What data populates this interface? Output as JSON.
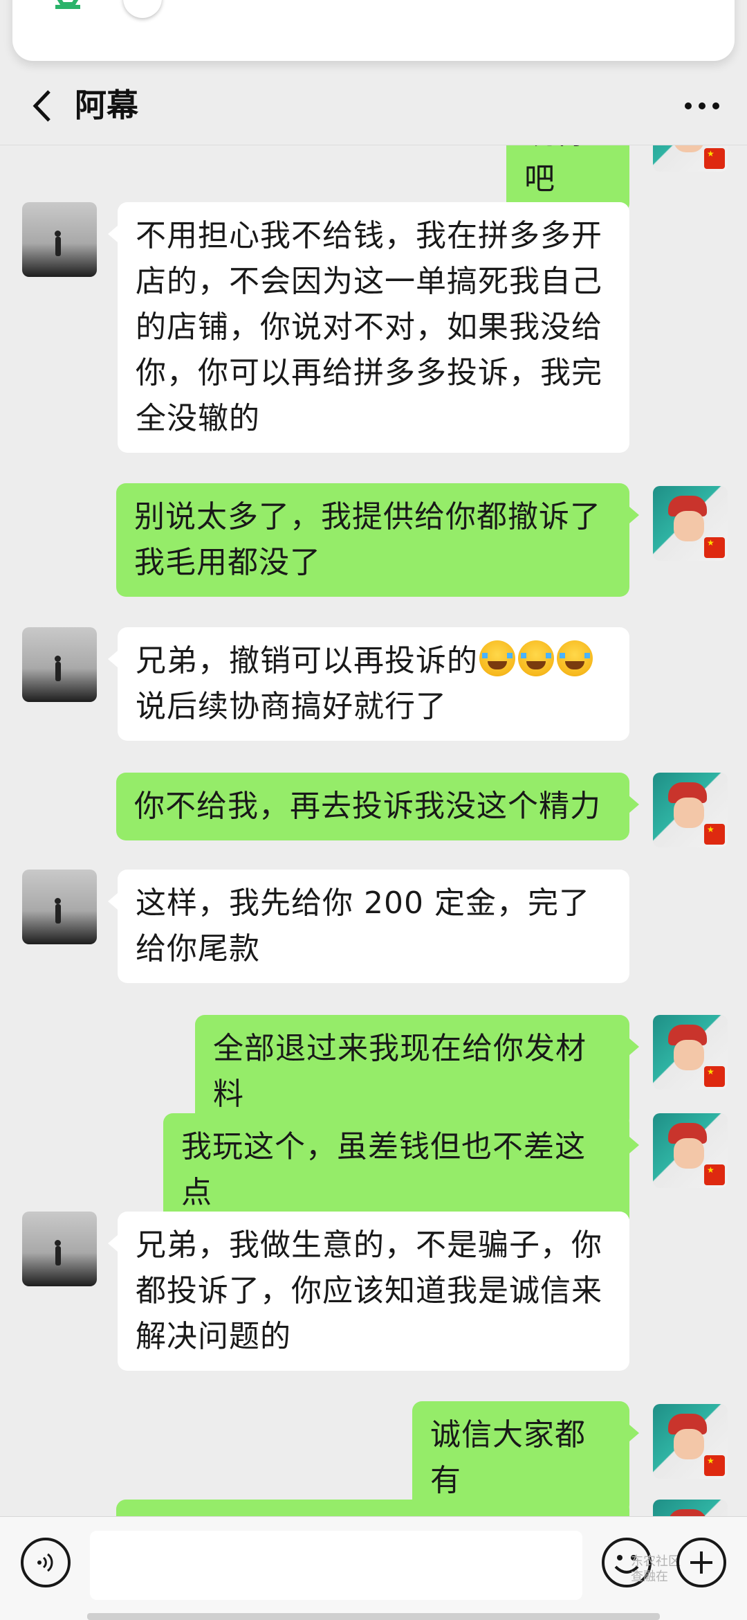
{
  "header": {
    "title": "阿幕"
  },
  "messages": [
    {
      "side": "right",
      "text": "晓得吧"
    },
    {
      "side": "left",
      "text": "不用担心我不给钱，我在拼多多开店的，不会因为这一单搞死我自己的店铺，你说对不对，如果我没给你，你可以再给拼多多投诉，我完全没辙的"
    },
    {
      "side": "right",
      "text": "别说太多了，我提供给你都撤诉了我毛用都没了"
    },
    {
      "side": "left",
      "text_before": "兄弟，撤销可以再投诉的",
      "emoji": "loudly-crying-face-icon",
      "emoji_count": 3,
      "text_after": "说后续协商搞好就行了"
    },
    {
      "side": "right",
      "text": "你不给我，再去投诉我没这个精力"
    },
    {
      "side": "left",
      "text": "这样，我先给你 200 定金，完了给你尾款"
    },
    {
      "side": "right",
      "text": "全部退过来我现在给你发材料"
    },
    {
      "side": "right",
      "text": "我玩这个，虽差钱但也不差这点"
    },
    {
      "side": "left",
      "text": "兄弟，我做生意的，不是骗子，你都投诉了，你应该知道我是诚信来解决问题的"
    },
    {
      "side": "right",
      "text": "诚信大家都有"
    }
  ],
  "input": {
    "value": ""
  },
  "watermark": {
    "line1": "东农社区",
    "line2": "查融在"
  }
}
